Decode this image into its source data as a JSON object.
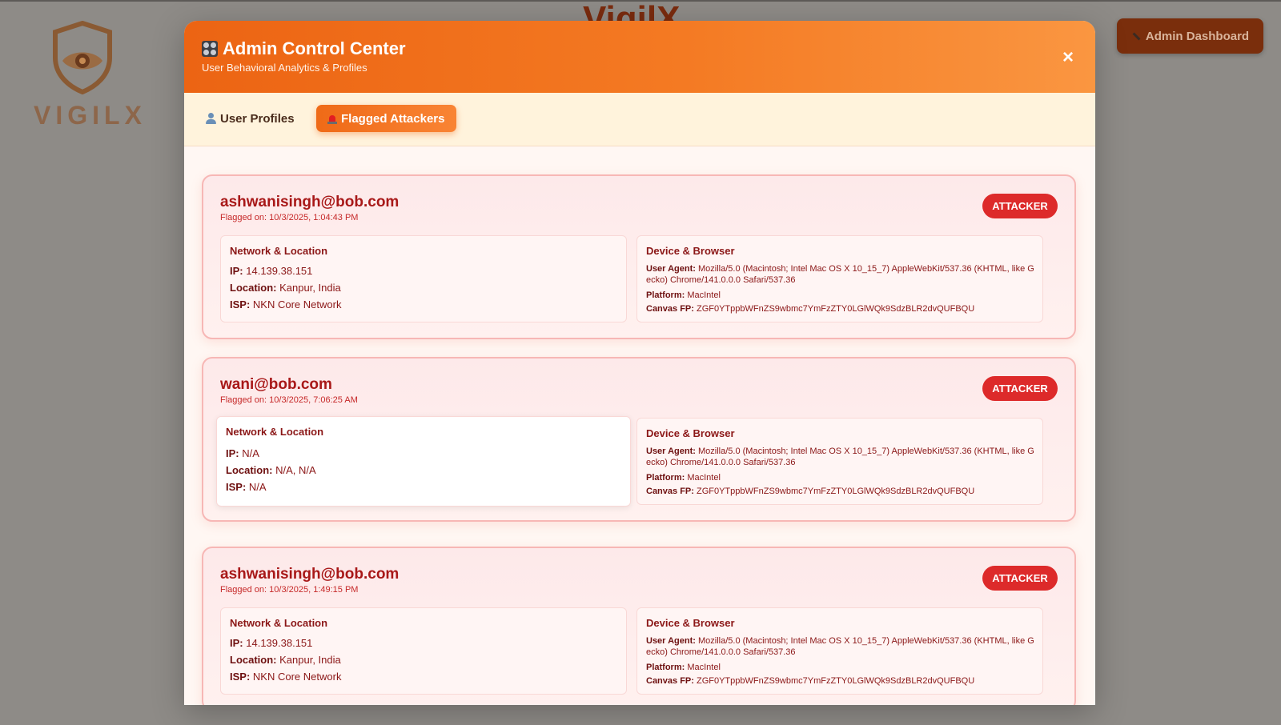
{
  "background": {
    "logo_text": "VIGILX",
    "heading": "VigilX",
    "admin_button": "Admin Dashboard"
  },
  "modal": {
    "title": "Admin Control Center",
    "subtitle": "User Behavioral Analytics & Profiles",
    "close_label": "×",
    "tabs": [
      {
        "label": "User Profiles",
        "active": false
      },
      {
        "label": "Flagged Attackers",
        "active": true
      }
    ]
  },
  "labels": {
    "network_title": "Network & Location",
    "device_title": "Device & Browser",
    "ip": "IP:",
    "location": "Location:",
    "isp": "ISP:",
    "user_agent": "User Agent:",
    "platform": "Platform:",
    "canvas_fp": "Canvas FP:"
  },
  "attackers": [
    {
      "email": "ashwanisingh@bob.com",
      "flagged_on": "Flagged on: 10/3/2025, 1:04:43 PM",
      "badge": "ATTACKER",
      "ip": "14.139.38.151",
      "location": "Kanpur, India",
      "isp": "NKN Core Network",
      "user_agent": "Mozilla/5.0 (Macintosh; Intel Mac OS X 10_15_7) AppleWebKit/537.36 (KHTML, like Gecko) Chrome/141.0.0.0 Safari/537.36",
      "platform": "MacIntel",
      "canvas_fp": "ZGF0YTppbWFnZS9wbmc7YmFzZTY0LGlWQk9SdzBLR2dvQUFBQU"
    },
    {
      "email": "wani@bob.com",
      "flagged_on": "Flagged on: 10/3/2025, 7:06:25 AM",
      "badge": "ATTACKER",
      "ip": "N/A",
      "location": "N/A, N/A",
      "isp": "N/A",
      "user_agent": "Mozilla/5.0 (Macintosh; Intel Mac OS X 10_15_7) AppleWebKit/537.36 (KHTML, like Gecko) Chrome/141.0.0.0 Safari/537.36",
      "platform": "MacIntel",
      "canvas_fp": "ZGF0YTppbWFnZS9wbmc7YmFzZTY0LGlWQk9SdzBLR2dvQUFBQU"
    },
    {
      "email": "ashwanisingh@bob.com",
      "flagged_on": "Flagged on: 10/3/2025, 1:49:15 PM",
      "badge": "ATTACKER",
      "ip": "14.139.38.151",
      "location": "Kanpur, India",
      "isp": "NKN Core Network",
      "user_agent": "Mozilla/5.0 (Macintosh; Intel Mac OS X 10_15_7) AppleWebKit/537.36 (KHTML, like Gecko) Chrome/141.0.0.0 Safari/537.36",
      "platform": "MacIntel",
      "canvas_fp": "ZGF0YTppbWFnZS9wbmc7YmFzZTY0LGlWQk9SdzBLR2dvQUFBQU"
    }
  ]
}
